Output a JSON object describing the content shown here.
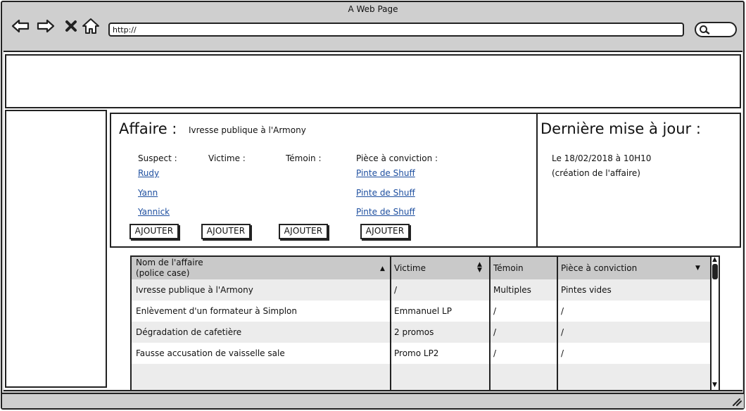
{
  "window": {
    "title": "A Web Page"
  },
  "browser": {
    "nav": {
      "back": "back-arrow-icon",
      "forward": "forward-arrow-icon",
      "stop": "close-icon",
      "home": "home-icon"
    },
    "url": "http://",
    "search_icon": "search-icon"
  },
  "affaire": {
    "label": "Affaire :",
    "name": "Ivresse publique à l'Armony",
    "columns": [
      {
        "header": "Suspect :",
        "items": [
          "Rudy",
          "Yann",
          "Yannick"
        ],
        "button": "AJOUTER"
      },
      {
        "header": "Victime :",
        "items": [],
        "button": "AJOUTER"
      },
      {
        "header": "Témoin :",
        "items": [],
        "button": "AJOUTER"
      },
      {
        "header": "Pièce à conviction :",
        "items": [
          "Pinte de Shuff",
          "Pinte de Shuff",
          "Pinte de Shuff"
        ],
        "button": "AJOUTER"
      }
    ]
  },
  "maj": {
    "title": "Dernière mise à jour :",
    "date": "Le 18/02/2018 à 10H10",
    "note": "(création de l'affaire)"
  },
  "table": {
    "headers": [
      "Nom de l'affaire\n(police case)",
      "Victime",
      "Témoin",
      "Pièce à conviction"
    ],
    "header_line1": "Nom de l'affaire",
    "header_line2": "(police case)",
    "rows": [
      [
        "Ivresse publique à l'Armony",
        "/",
        "Multiples",
        "Pintes vides"
      ],
      [
        "Enlèvement d'un formateur à Simplon",
        "Emmanuel LP",
        "/",
        "/"
      ],
      [
        "Dégradation de cafetière",
        "2 promos",
        "/",
        "/"
      ],
      [
        "Fausse accusation de vaisselle sale",
        "Promo LP2",
        "/",
        "/"
      ]
    ]
  },
  "colors": {
    "link": "#1d4e9f",
    "chrome": "#cfcfcf",
    "table_header": "#c9c9c9",
    "row_alt": "#ececec"
  }
}
